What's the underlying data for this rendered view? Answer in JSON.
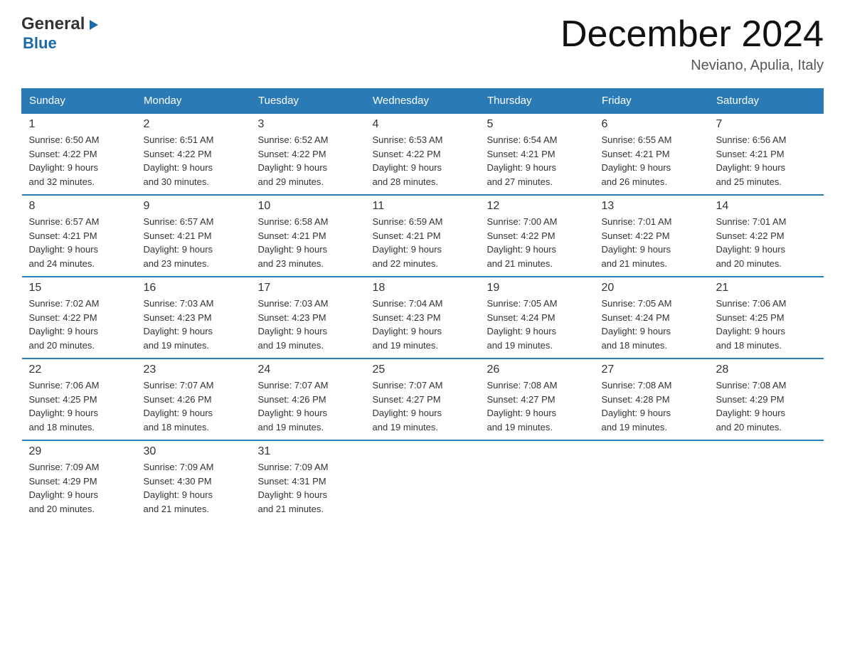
{
  "header": {
    "logo": {
      "part1": "General",
      "arrow": "▶",
      "part2": "Blue"
    },
    "title": "December 2024",
    "location": "Neviano, Apulia, Italy"
  },
  "days_of_week": [
    "Sunday",
    "Monday",
    "Tuesday",
    "Wednesday",
    "Thursday",
    "Friday",
    "Saturday"
  ],
  "weeks": [
    [
      {
        "day": "1",
        "sunrise": "6:50 AM",
        "sunset": "4:22 PM",
        "daylight": "9 hours and 32 minutes."
      },
      {
        "day": "2",
        "sunrise": "6:51 AM",
        "sunset": "4:22 PM",
        "daylight": "9 hours and 30 minutes."
      },
      {
        "day": "3",
        "sunrise": "6:52 AM",
        "sunset": "4:22 PM",
        "daylight": "9 hours and 29 minutes."
      },
      {
        "day": "4",
        "sunrise": "6:53 AM",
        "sunset": "4:22 PM",
        "daylight": "9 hours and 28 minutes."
      },
      {
        "day": "5",
        "sunrise": "6:54 AM",
        "sunset": "4:21 PM",
        "daylight": "9 hours and 27 minutes."
      },
      {
        "day": "6",
        "sunrise": "6:55 AM",
        "sunset": "4:21 PM",
        "daylight": "9 hours and 26 minutes."
      },
      {
        "day": "7",
        "sunrise": "6:56 AM",
        "sunset": "4:21 PM",
        "daylight": "9 hours and 25 minutes."
      }
    ],
    [
      {
        "day": "8",
        "sunrise": "6:57 AM",
        "sunset": "4:21 PM",
        "daylight": "9 hours and 24 minutes."
      },
      {
        "day": "9",
        "sunrise": "6:57 AM",
        "sunset": "4:21 PM",
        "daylight": "9 hours and 23 minutes."
      },
      {
        "day": "10",
        "sunrise": "6:58 AM",
        "sunset": "4:21 PM",
        "daylight": "9 hours and 23 minutes."
      },
      {
        "day": "11",
        "sunrise": "6:59 AM",
        "sunset": "4:21 PM",
        "daylight": "9 hours and 22 minutes."
      },
      {
        "day": "12",
        "sunrise": "7:00 AM",
        "sunset": "4:22 PM",
        "daylight": "9 hours and 21 minutes."
      },
      {
        "day": "13",
        "sunrise": "7:01 AM",
        "sunset": "4:22 PM",
        "daylight": "9 hours and 21 minutes."
      },
      {
        "day": "14",
        "sunrise": "7:01 AM",
        "sunset": "4:22 PM",
        "daylight": "9 hours and 20 minutes."
      }
    ],
    [
      {
        "day": "15",
        "sunrise": "7:02 AM",
        "sunset": "4:22 PM",
        "daylight": "9 hours and 20 minutes."
      },
      {
        "day": "16",
        "sunrise": "7:03 AM",
        "sunset": "4:23 PM",
        "daylight": "9 hours and 19 minutes."
      },
      {
        "day": "17",
        "sunrise": "7:03 AM",
        "sunset": "4:23 PM",
        "daylight": "9 hours and 19 minutes."
      },
      {
        "day": "18",
        "sunrise": "7:04 AM",
        "sunset": "4:23 PM",
        "daylight": "9 hours and 19 minutes."
      },
      {
        "day": "19",
        "sunrise": "7:05 AM",
        "sunset": "4:24 PM",
        "daylight": "9 hours and 19 minutes."
      },
      {
        "day": "20",
        "sunrise": "7:05 AM",
        "sunset": "4:24 PM",
        "daylight": "9 hours and 18 minutes."
      },
      {
        "day": "21",
        "sunrise": "7:06 AM",
        "sunset": "4:25 PM",
        "daylight": "9 hours and 18 minutes."
      }
    ],
    [
      {
        "day": "22",
        "sunrise": "7:06 AM",
        "sunset": "4:25 PM",
        "daylight": "9 hours and 18 minutes."
      },
      {
        "day": "23",
        "sunrise": "7:07 AM",
        "sunset": "4:26 PM",
        "daylight": "9 hours and 18 minutes."
      },
      {
        "day": "24",
        "sunrise": "7:07 AM",
        "sunset": "4:26 PM",
        "daylight": "9 hours and 19 minutes."
      },
      {
        "day": "25",
        "sunrise": "7:07 AM",
        "sunset": "4:27 PM",
        "daylight": "9 hours and 19 minutes."
      },
      {
        "day": "26",
        "sunrise": "7:08 AM",
        "sunset": "4:27 PM",
        "daylight": "9 hours and 19 minutes."
      },
      {
        "day": "27",
        "sunrise": "7:08 AM",
        "sunset": "4:28 PM",
        "daylight": "9 hours and 19 minutes."
      },
      {
        "day": "28",
        "sunrise": "7:08 AM",
        "sunset": "4:29 PM",
        "daylight": "9 hours and 20 minutes."
      }
    ],
    [
      {
        "day": "29",
        "sunrise": "7:09 AM",
        "sunset": "4:29 PM",
        "daylight": "9 hours and 20 minutes."
      },
      {
        "day": "30",
        "sunrise": "7:09 AM",
        "sunset": "4:30 PM",
        "daylight": "9 hours and 21 minutes."
      },
      {
        "day": "31",
        "sunrise": "7:09 AM",
        "sunset": "4:31 PM",
        "daylight": "9 hours and 21 minutes."
      },
      null,
      null,
      null,
      null
    ]
  ],
  "labels": {
    "sunrise": "Sunrise:",
    "sunset": "Sunset:",
    "daylight": "Daylight:"
  },
  "colors": {
    "header_bg": "#2a7ab5",
    "border": "#2a7ab5"
  }
}
